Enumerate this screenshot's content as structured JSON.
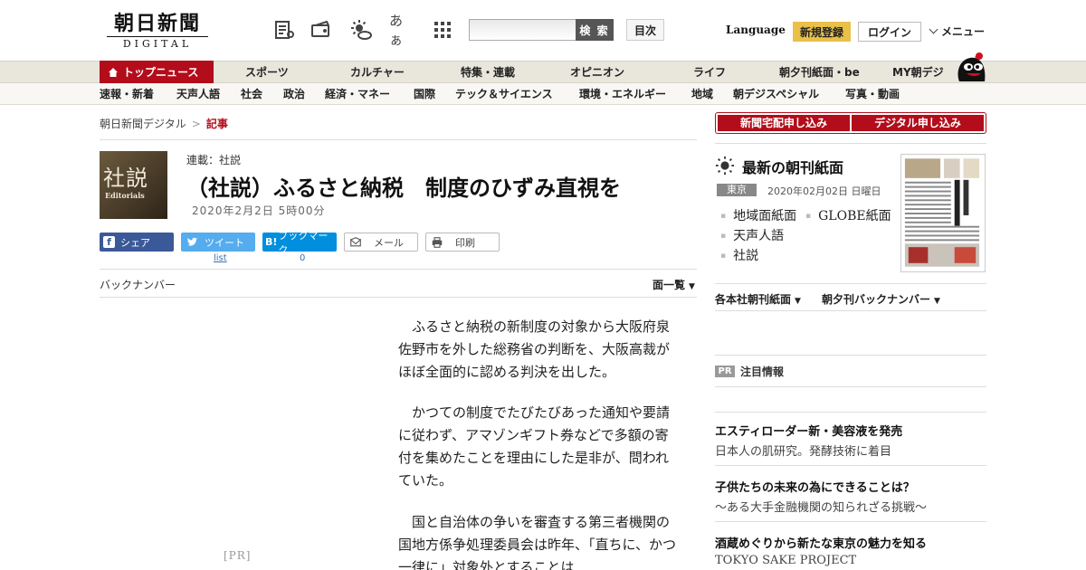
{
  "header": {
    "logo_main": "朝日新聞",
    "logo_sub": "DIGITAL",
    "font_size_icon_label": "あぁ",
    "search_button": "検 索",
    "index_button": "目次",
    "language": "Language",
    "register": "新規登録",
    "login": "ログイン",
    "menu": "メニュー"
  },
  "nav_primary": [
    "トップニュース",
    "スポーツ",
    "カルチャー",
    "特集・連載",
    "オピニオン",
    "ライフ",
    "朝夕刊紙面・be",
    "MY朝デジ"
  ],
  "nav_secondary": [
    "速報・新着",
    "天声人語",
    "社会",
    "政治",
    "経済・マネー",
    "国際",
    "テック＆サイエンス",
    "環境・エネルギー",
    "地域",
    "朝デジスペシャル",
    "写真・動画"
  ],
  "breadcrumb": {
    "home": "朝日新聞デジタル",
    "sep": ">",
    "current": "記事"
  },
  "article": {
    "thumb_kanji": "社説",
    "thumb_en": "Editorials",
    "series": "連載：社説",
    "headline": "（社説）ふるさと納税　制度のひずみ直視を",
    "date": "2020年2月2日 5時00分",
    "share": {
      "facebook": "シェア",
      "twitter": "ツイート",
      "hatena": "ブックマーク",
      "mail": "メール",
      "print": "印刷",
      "twitter_count": "list",
      "hatena_count": "0"
    },
    "back_number": "バックナンバー",
    "page_list": "面一覧",
    "pr_left": "[PR]",
    "paragraphs": [
      "ふるさと納税の新制度の対象から大阪府泉佐野市を外した総務省の判断を、大阪高裁がほぼ全面的に認める判決を出した。",
      "かつての制度でたびたびあった通知や要請に従わず、アマゾンギフト券などで多額の寄付を集めたことを理由にした是非が、問われていた。",
      "国と自治体の争いを審査する第三者機関の国地方係争処理委員会は昨年、「直ちに、かつ一律に」対象外とすることは"
    ]
  },
  "sidebar": {
    "subscribe_paper": "新聞宅配申し込み",
    "subscribe_digital": "デジタル申し込み",
    "paper_title": "最新の朝刊紙面",
    "edition": "東京",
    "paper_date": "2020年02月02日 日曜日",
    "links": [
      "地域面紙面",
      "GLOBE紙面",
      "天声人語",
      "社説"
    ],
    "dropdown_1": "各本社朝刊紙面",
    "dropdown_2": "朝夕刊バックナンバー",
    "pr_badge": "PR",
    "pr_heading": "注目情報",
    "ads": [
      {
        "title": "エスティローダー新・美容液を発売",
        "sub": "日本人の肌研究。発酵技術に着目"
      },
      {
        "title": "子供たちの未来の為にできることは？",
        "sub": "～ある大手金融機関の知られざる挑戦～"
      },
      {
        "title": "酒蔵めぐりから新たな東京の魅力を知る",
        "sub": "TOKYO SAKE PROJECT"
      }
    ]
  },
  "colors": {
    "brand_red": "#b30c1a",
    "register_yellow": "#e8c04a",
    "facebook": "#3b5998",
    "twitter": "#55acee",
    "hatena": "#008fde"
  }
}
